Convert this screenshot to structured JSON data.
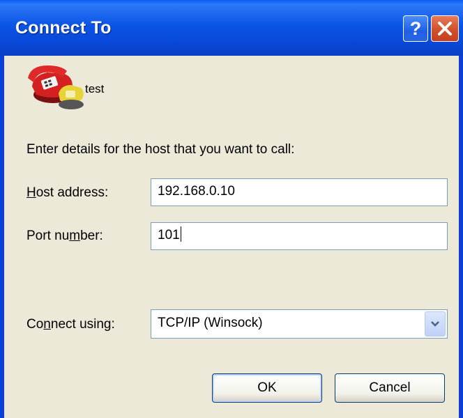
{
  "window": {
    "title": "Connect To",
    "help_glyph": "?",
    "help_icon": "help-icon",
    "close_icon": "close-icon"
  },
  "connection": {
    "name": "test",
    "icon": "telephone-icon"
  },
  "form": {
    "instructions": "Enter details for the host that you want to call:",
    "host_label_access": "H",
    "host_label_rest": "ost address:",
    "host_value": "192.168.0.10",
    "port_label_pre": "Port nu",
    "port_label_access": "m",
    "port_label_post": "ber:",
    "port_value": "101",
    "connect_label_pre": "Co",
    "connect_label_access": "n",
    "connect_label_post": "nect using:",
    "connect_value": "TCP/IP (Winsock)"
  },
  "buttons": {
    "ok": "OK",
    "cancel": "Cancel"
  },
  "colors": {
    "titlebar": "#0a55e6",
    "client": "#ece9d8",
    "close_button": "#d2502c"
  }
}
